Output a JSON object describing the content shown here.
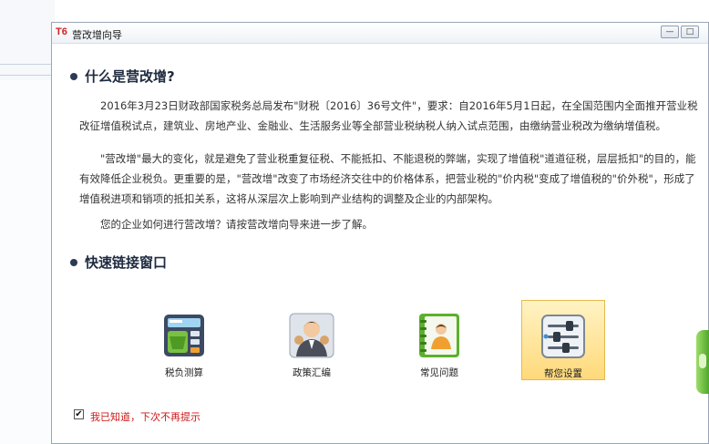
{
  "window": {
    "app_badge": "T6",
    "title": "营改增向导",
    "minimize_symbol": "—",
    "maximize_symbol": "□"
  },
  "section1": {
    "heading": "什么是营改增?",
    "paragraphs": [
      "2016年3月23日财政部国家税务总局发布\"财税〔2016〕36号文件\"，要求：自2016年5月1日起，在全国范围内全面推开营业税改征增值税试点，建筑业、房地产业、金融业、生活服务业等全部营业税纳税人纳入试点范围，由缴纳营业税改为缴纳增值税。",
      "\"营改增\"最大的变化，就是避免了营业税重复征税、不能抵扣、不能退税的弊端，实现了增值税\"道道征税，层层抵扣\"的目的，能有效降低企业税负。更重要的是，\"营改增\"改变了市场经济交往中的价格体系，把营业税的\"价内税\"变成了增值税的\"价外税\"，形成了增值税进项和销项的抵扣关系，这将从深层次上影响到产业结构的调整及企业的内部架构。",
      "您的企业如何进行营改增？请按营改增向导来进一步了解。"
    ]
  },
  "section2": {
    "heading": "快速链接窗口",
    "links": [
      {
        "label": "税负测算",
        "icon": "calculator-icon"
      },
      {
        "label": "政策汇编",
        "icon": "advisor-person-icon"
      },
      {
        "label": "常见问题",
        "icon": "notebook-person-icon"
      },
      {
        "label": "帮您设置",
        "icon": "settings-sliders-icon"
      }
    ]
  },
  "footer": {
    "checkbox_checked": true,
    "checkbox_mark": "✔",
    "checkbox_label": "我已知道，下次不再提示"
  },
  "colors": {
    "accent_red": "#cc1a1a",
    "selected_tile": "#ffd97a",
    "heading": "#1f2b40"
  }
}
